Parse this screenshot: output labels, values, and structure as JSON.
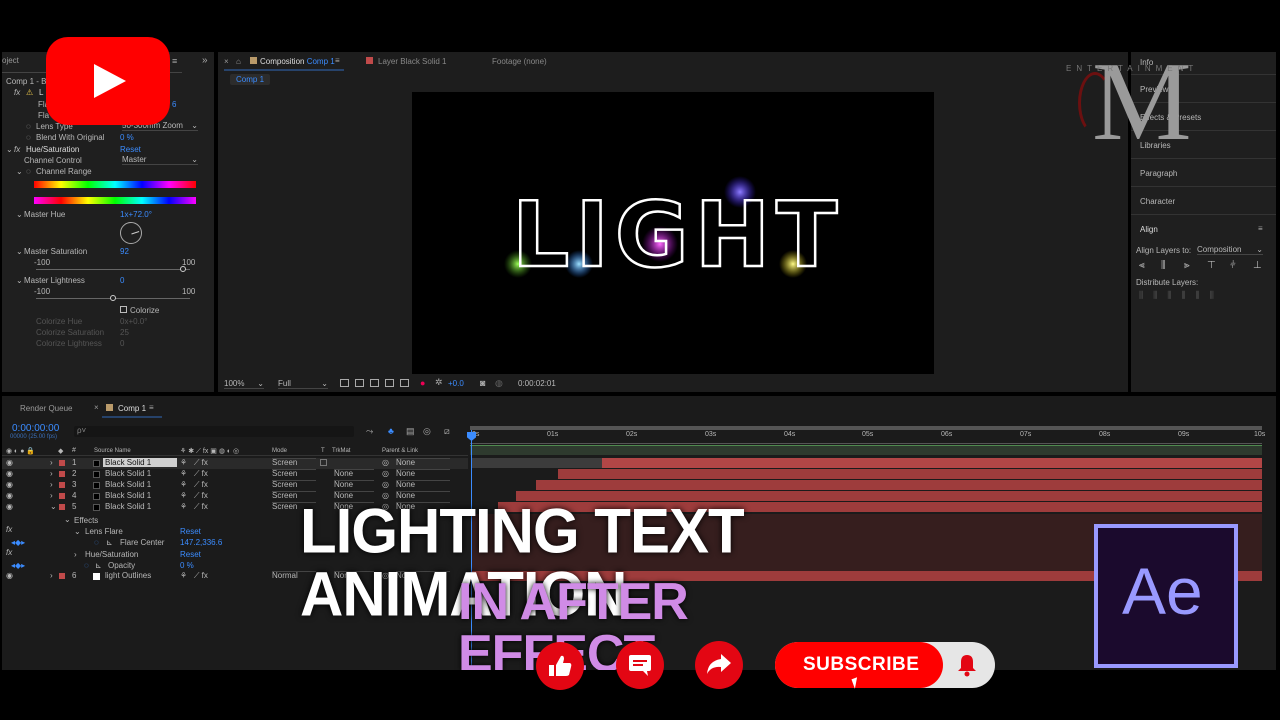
{
  "effects_panel": {
    "tab_fragment": "oject",
    "comp_crumb": "Comp 1 - Bl",
    "lens_flare": {
      "header": "L",
      "row1": "Fla",
      "row1_value": "6",
      "row2": "Fla",
      "lens_type_label": "Lens Type",
      "lens_type_value": "50-300mm Zoom",
      "blend_label": "Blend With Original",
      "blend_value": "0 %"
    },
    "hue": {
      "header": "Hue/Saturation",
      "reset": "Reset",
      "channel_control_label": "Channel Control",
      "channel_control_value": "Master",
      "channel_range_label": "Channel Range",
      "master_hue_label": "Master Hue",
      "master_hue_value": "1x+72.0°",
      "master_sat_label": "Master Saturation",
      "master_sat_value": "92",
      "master_sat_min": "-100",
      "master_sat_max": "100",
      "master_light_label": "Master Lightness",
      "master_light_value": "0",
      "master_light_min": "-100",
      "master_light_max": "100",
      "colorize_label": "Colorize",
      "colorize_hue_label": "Colorize Hue",
      "colorize_hue_value": "0x+0.0°",
      "colorize_sat_label": "Colorize Saturation",
      "colorize_sat_value": "25",
      "colorize_light_label": "Colorize Lightness",
      "colorize_light_value": "0"
    }
  },
  "viewer": {
    "tab_comp_prefix": "Composition",
    "tab_comp_name": "Comp 1",
    "tab_layer_prefix": "Layer",
    "tab_layer_name": "Black Solid 1",
    "tab_footage": "Footage (none)",
    "comp_chip": "Comp 1",
    "canvas_text": "LIGHT",
    "zoom": "100%",
    "resolution": "Full",
    "exposure": "+0.0",
    "timecode": "0:00:02:01"
  },
  "right_panel": {
    "info": "Info",
    "preview": "Preview",
    "effects_presets": "Effects & Presets",
    "libraries": "Libraries",
    "paragraph": "Paragraph",
    "character": "Character",
    "align": "Align",
    "align_layers_to": "Align Layers to:",
    "align_target": "Composition",
    "distribute_layers": "Distribute Layers:"
  },
  "watermark": {
    "letters": "M",
    "entertainment": "ENTERTAINMENT"
  },
  "timeline": {
    "tab_render_queue": "Render Queue",
    "tab_comp": "Comp 1",
    "timecode": "0:00:00:00",
    "fps": "00000 (25.00 fps)",
    "search_placeholder": "ρ˅",
    "headers": {
      "source_name": "Source Name",
      "mode": "Mode",
      "t": "T",
      "trkmat": "TrkMat",
      "parent": "Parent & Link"
    },
    "ruler": [
      "0s",
      "01s",
      "02s",
      "03s",
      "04s",
      "05s",
      "06s",
      "07s",
      "08s",
      "09s",
      "10s"
    ],
    "layers": [
      {
        "num": "1",
        "name": "Black Solid 1",
        "mode": "Screen",
        "trkmat": "",
        "parent": "None"
      },
      {
        "num": "2",
        "name": "Black Solid 1",
        "mode": "Screen",
        "trkmat": "None",
        "parent": "None"
      },
      {
        "num": "3",
        "name": "Black Solid 1",
        "mode": "Screen",
        "trkmat": "None",
        "parent": "None"
      },
      {
        "num": "4",
        "name": "Black Solid 1",
        "mode": "Screen",
        "trkmat": "None",
        "parent": "None"
      },
      {
        "num": "5",
        "name": "Black Solid 1",
        "mode": "Screen",
        "trkmat": "None",
        "parent": "None"
      }
    ],
    "effects_label": "Effects",
    "lens_flare_label": "Lens Flare",
    "lens_flare_reset": "Reset",
    "flare_center_label": "Flare Center",
    "flare_center_value": "147.2,336.6",
    "hue_sat_label": "Hue/Saturation",
    "hue_sat_reset": "Reset",
    "opacity_label": "Opacity",
    "opacity_value": "0 %",
    "layer6": {
      "num": "6",
      "name": "light Outlines",
      "mode": "Normal",
      "trkmat": "None",
      "parent": "None"
    }
  },
  "overlay": {
    "title_line1": "LIGHTING TEXT ANIMATION",
    "title_line2": "IN AFTER EFFECT",
    "ae_logo": "Ae",
    "subscribe": "SUBSCRIBE"
  },
  "colors": {
    "youtube_red": "#ff0000",
    "title_purple": "#d08be6",
    "ae_purple": "#9999ff",
    "ae_bg": "#1b0a2d",
    "layer_bar": "#9e3c3c",
    "ae_blue": "#3b8cff"
  }
}
